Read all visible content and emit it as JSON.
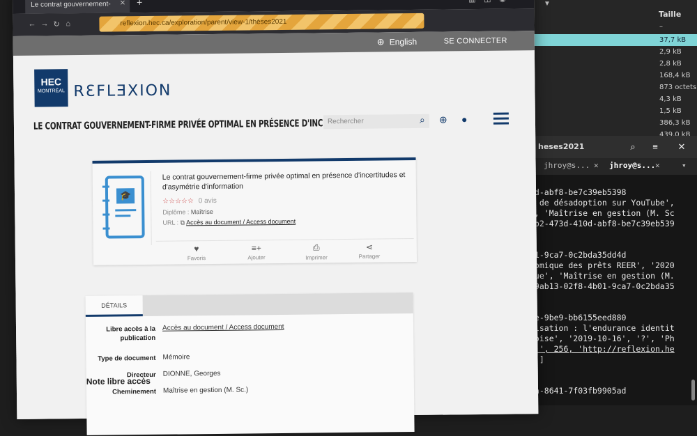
{
  "browser": {
    "tab_title": "Le contrat gouvernement-",
    "url": "reflexion.hec.ca/exploration/parent/view-1/thèses2021"
  },
  "site": {
    "language": "English",
    "connect": "SE CONNECTER",
    "logo_top": "HEC",
    "logo_bottom": "MONTRÉAL",
    "brand": "RƐFLƎXION",
    "header_title": "LE CONTRAT GOUVERNEMENT-FIRME PRIVÉE OPTIMAL EN PRÉSENCE D'INCERTITUDES ...",
    "search_placeholder": "Rechercher"
  },
  "card": {
    "title": "Le contrat gouvernement-firme privée optimal en présence d'incertitudes et d'asymétrie d'information",
    "stars": "☆☆☆☆☆",
    "rating_count": "0 avis",
    "diploma_key": "Diplôme :",
    "diploma_value": "Maîtrise",
    "url_key": "URL :",
    "url_value": "Accès au document / Access document",
    "actions": [
      "Favoris",
      "Ajouter",
      "Imprimer",
      "Partager"
    ]
  },
  "details": {
    "tab": "DÉTAILS",
    "rows": [
      {
        "label": "Libre accès à la publication",
        "value": "Accès au document / Access document"
      },
      {
        "label": "Type de document",
        "value": "Mémoire"
      },
      {
        "label": "Directeur",
        "value": "DIONNE, Georges"
      },
      {
        "label": "Cheminement",
        "value": "Maîtrise en gestion (M. Sc.)"
      }
    ],
    "section_heading": "Note libre accès"
  },
  "file_panel": {
    "header": "Taille",
    "sizes": [
      "–",
      "37,7 kB",
      "2,9 kB",
      "2,8 kB",
      "168,4 kB",
      "873 octets",
      "4,3 kB",
      "1,5 kB",
      "386,3 kB",
      "439,0 kB"
    ]
  },
  "terminal": {
    "title": "heses2021",
    "tabs": [
      "jhroy@s...",
      "jhroy@s..."
    ],
    "lines": [
      "0d-abf8-be7c39eb5398",
      "e de désadoption sur YouTube',",
      "', 'Maîtrise en gestion (M. Sc",
      "2b2-473d-410d-abf8-be7c39eb539",
      "",
      "",
      "01-9ca7-0c2bda35dd4d",
      "nomique des prêts REER', '2020",
      "nue', 'Maîtrise en gestion (M.",
      "99ab13-02f8-4b01-9ca7-0c2bda35",
      "",
      "",
      "de-9be9-bb6155eed880",
      "lisation : l'endurance identit",
      "coise', '2019-10-16', '?', 'Ph",
      ".)', 256, 'http://reflexion.he",
      "0']",
      "",
      "",
      "ea-8641-7f03fb9905ad"
    ]
  }
}
